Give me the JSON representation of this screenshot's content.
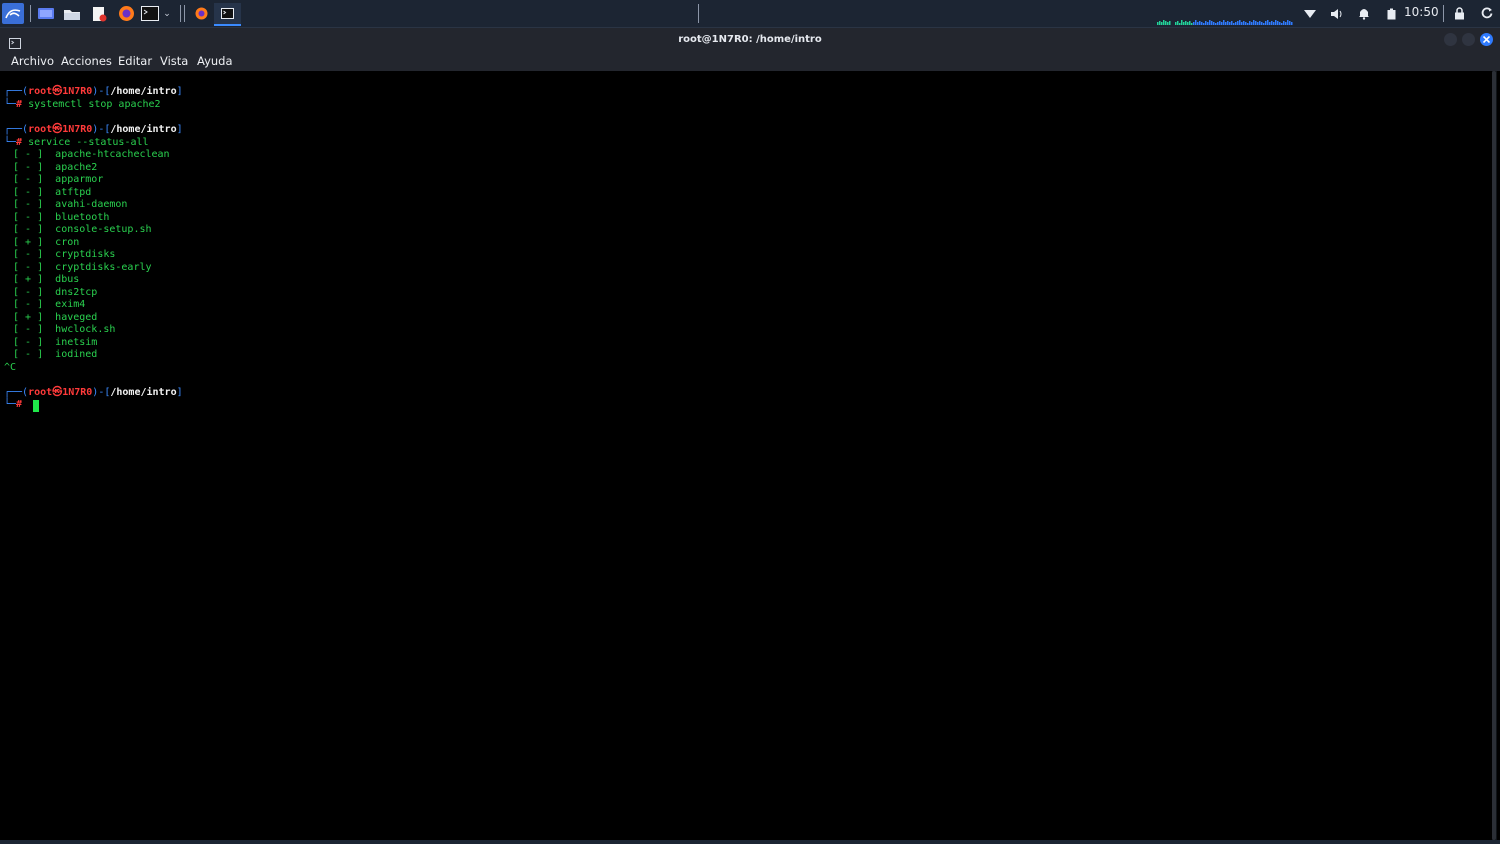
{
  "taskbar": {
    "clock": "10:50",
    "launchers": [
      "kali-menu-icon",
      "desktop-icon",
      "file-manager-icon",
      "text-editor-icon",
      "firefox-icon",
      "terminal-icon"
    ],
    "tasks": [
      "firefox-task-icon",
      "terminal-task-icon"
    ],
    "tray": [
      "network-wifi-icon",
      "volume-icon",
      "notifications-icon",
      "battery-icon",
      "lock-icon",
      "power-icon"
    ]
  },
  "window": {
    "title": "root@1N7R0: /home/intro"
  },
  "menu": {
    "items": [
      "Archivo",
      "Acciones",
      "Editar",
      "Vista",
      "Ayuda"
    ]
  },
  "terminal": {
    "prompt": {
      "box_top": "┌──(",
      "user": "root",
      "at": "㉿",
      "host": "1N7R0",
      "mid": ")-[",
      "path": "/home/intro",
      "end": "]",
      "box_bottom": "└─",
      "hash": "#"
    },
    "commands": [
      "systemctl stop apache2",
      "service --status-all"
    ],
    "services": [
      {
        "status": "-",
        "name": "apache-htcacheclean"
      },
      {
        "status": "-",
        "name": "apache2"
      },
      {
        "status": "-",
        "name": "apparmor"
      },
      {
        "status": "-",
        "name": "atftpd"
      },
      {
        "status": "-",
        "name": "avahi-daemon"
      },
      {
        "status": "-",
        "name": "bluetooth"
      },
      {
        "status": "-",
        "name": "console-setup.sh"
      },
      {
        "status": "+",
        "name": "cron"
      },
      {
        "status": "-",
        "name": "cryptdisks"
      },
      {
        "status": "-",
        "name": "cryptdisks-early"
      },
      {
        "status": "+",
        "name": "dbus"
      },
      {
        "status": "-",
        "name": "dns2tcp"
      },
      {
        "status": "-",
        "name": "exim4"
      },
      {
        "status": "+",
        "name": "haveged"
      },
      {
        "status": "-",
        "name": "hwclock.sh"
      },
      {
        "status": "-",
        "name": "inetsim"
      },
      {
        "status": "-",
        "name": "iodined"
      }
    ],
    "interrupt": "^C"
  },
  "colors": {
    "panel": "#1c2533",
    "titlebar": "#23262e",
    "terminal_bg": "#000000",
    "prompt_blue": "#3b8bff",
    "prompt_red": "#ff3a3a",
    "text_green": "#2ad14f",
    "close_button": "#2f7bff"
  }
}
